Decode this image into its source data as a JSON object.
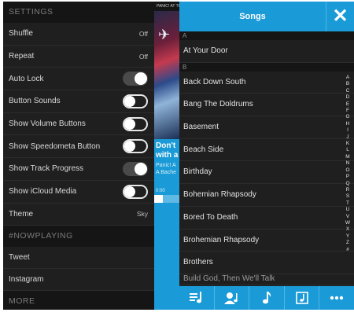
{
  "settings": {
    "header": "SETTINGS",
    "rows": [
      {
        "label": "Shuffle",
        "value": "Off"
      },
      {
        "label": "Repeat",
        "value": "Off"
      }
    ],
    "toggles": [
      {
        "label": "Auto Lock",
        "on": true
      },
      {
        "label": "Button Sounds",
        "on": false
      },
      {
        "label": "Show Volume Buttons",
        "on": false
      },
      {
        "label": "Show Speedometa Button",
        "on": false
      },
      {
        "label": "Show Track Progress",
        "on": true
      },
      {
        "label": "Show iCloud Media",
        "on": false
      }
    ],
    "theme": {
      "label": "Theme",
      "value": "Sky"
    },
    "nowplaying_header": "#NOWPLAYING",
    "nowplaying_items": [
      "Tweet",
      "Instagram"
    ],
    "more_header": "MORE"
  },
  "now_playing": {
    "album_band": "PANIC! AT THE",
    "title": "Don't",
    "title_line2": "with a",
    "artist": "Panic! A",
    "album": "A Bache",
    "elapsed": "0:00",
    "progress": 0.35
  },
  "songs": {
    "title": "Songs",
    "close_icon": "close-icon",
    "sections": [
      {
        "letter": "A",
        "songs": [
          "At Your Door"
        ]
      },
      {
        "letter": "B",
        "songs": [
          "Back Down South",
          "Bang The Doldrums",
          "Basement",
          "Beach Side",
          "Birthday",
          "Bohemian Rhapsody",
          "Bored To Death",
          "Brohemian Rhapsody",
          "Brothers"
        ]
      }
    ],
    "partial_song": "Build God, Then We'll Talk",
    "index_letters": [
      "A",
      "B",
      "C",
      "D",
      "E",
      "F",
      "G",
      "H",
      "I",
      "J",
      "K",
      "L",
      "M",
      "N",
      "O",
      "P",
      "Q",
      "R",
      "S",
      "T",
      "U",
      "V",
      "W",
      "X",
      "Y",
      "Z",
      "#"
    ],
    "tabs": [
      "playlist-icon",
      "artist-icon",
      "music-note-icon",
      "album-icon",
      "more-icon"
    ]
  },
  "colors": {
    "accent": "#1a9ad6",
    "panel": "#1f1f1f",
    "header": "#151515"
  }
}
